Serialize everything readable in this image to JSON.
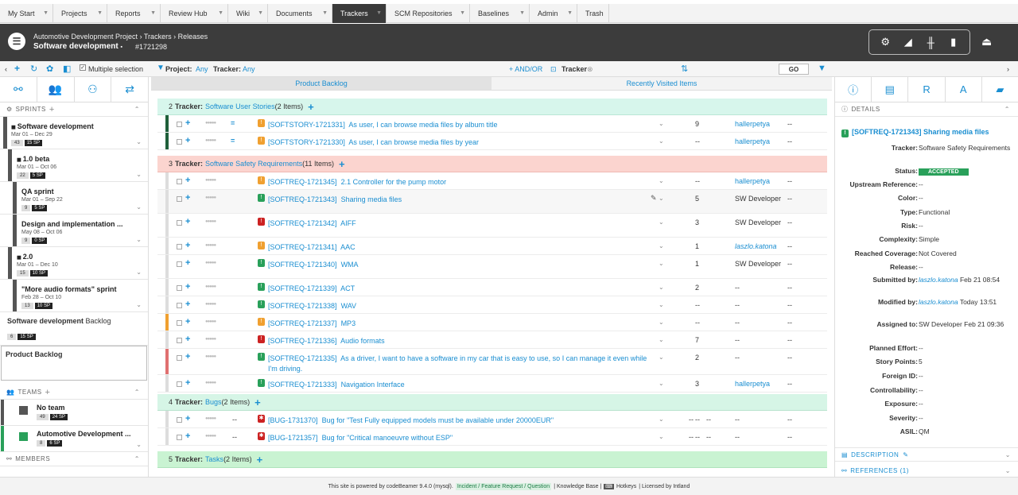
{
  "nav": [
    "My Start",
    "Projects",
    "Reports",
    "Review Hub",
    "Wiki",
    "Documents",
    "Trackers",
    "SCM Repositories",
    "Baselines",
    "Admin",
    "Trash"
  ],
  "header": {
    "breadcrumb": "Automotive Development Project › Trackers › Releases",
    "title": "Software development",
    "title_marker": "▪",
    "id": "#1721298"
  },
  "toolbar": {
    "multiple_selection": "Multiple selection",
    "project_label": "Project:",
    "project_value": "Any",
    "tracker_label": "Tracker:",
    "tracker_value": "Any",
    "andor": "+ AND/OR",
    "tracker_filter": "Tracker",
    "go": "GO"
  },
  "left": {
    "sprints_header": "SPRINTS",
    "sprints": [
      {
        "title": "Software development",
        "dates": "Mar 01 – Dec 29",
        "a": "43",
        "b": "15"
      },
      {
        "title": "1.0 beta",
        "dates": "Mar 01 – Oct 06",
        "a": "22",
        "b": "5"
      },
      {
        "title": "QA sprint",
        "dates": "Mar 01 – Sep 22",
        "a": "9",
        "b": "5"
      },
      {
        "title": "Design and implementation ...",
        "dates": "May 08 – Oct 06",
        "a": "9",
        "b": "0"
      },
      {
        "title": "2.0",
        "dates": "Mar 01 – Dec 10",
        "a": "15",
        "b": "10"
      },
      {
        "title": "\"More audio formats\" sprint",
        "dates": "Feb 28 – Oct 10",
        "a": "13",
        "b": "10"
      }
    ],
    "backlog1_title": "Software development",
    "backlog1_suffix": "Backlog",
    "backlog1_a": "6",
    "backlog1_b": "15",
    "backlog2": "Product Backlog",
    "teams_header": "TEAMS",
    "teams": [
      {
        "title": "No team",
        "a": "49",
        "b": "24"
      },
      {
        "title": "Automotive Development ...",
        "a": "8",
        "b": "6"
      }
    ],
    "members_header": "MEMBERS"
  },
  "tabs": [
    "Product Backlog",
    "Recently Visited Items"
  ],
  "groups": [
    {
      "num": "2",
      "label": "Tracker:",
      "name": "Software User Stories",
      "count": "(2 Items)"
    },
    {
      "num": "3",
      "label": "Tracker:",
      "name": "Software Safety Requirements",
      "count": "(11 Items)"
    },
    {
      "num": "4",
      "label": "Tracker:",
      "name": "Bugs",
      "count": "(2 Items)"
    },
    {
      "num": "5",
      "label": "Tracker:",
      "name": "Tasks",
      "count": "(2 Items)"
    }
  ],
  "rows": [
    {
      "id": "[SOFTSTORY-1721331]",
      "title": "As user, I can browse media files by album title",
      "num": "9",
      "assignee": "hallerpetya",
      "dash": "--"
    },
    {
      "id": "[SOFTSTORY-1721330]",
      "title": "As user, I can browse media files by year",
      "num": "--",
      "assignee": "hallerpetya",
      "dash": "--"
    },
    {
      "id": "[SOFTREQ-1721345]",
      "title": "2.1 Controller for the pump motor",
      "num": "--",
      "assignee": "hallerpetya",
      "dash": "--"
    },
    {
      "id": "[SOFTREQ-1721343]",
      "title": "Sharing media files",
      "num": "5",
      "assignee": "SW Developer",
      "dash": "--"
    },
    {
      "id": "[SOFTREQ-1721342]",
      "title": "AIFF",
      "num": "3",
      "assignee": "SW Developer",
      "dash": "--"
    },
    {
      "id": "[SOFTREQ-1721341]",
      "title": "AAC",
      "num": "1",
      "assignee": "laszlo.katona",
      "dash": "--"
    },
    {
      "id": "[SOFTREQ-1721340]",
      "title": "WMA",
      "num": "1",
      "assignee": "SW Developer",
      "dash": "--"
    },
    {
      "id": "[SOFTREQ-1721339]",
      "title": "ACT",
      "num": "2",
      "assignee": "--",
      "dash": "--"
    },
    {
      "id": "[SOFTREQ-1721338]",
      "title": "WAV",
      "num": "--",
      "assignee": "--",
      "dash": "--"
    },
    {
      "id": "[SOFTREQ-1721337]",
      "title": "MP3",
      "num": "--",
      "assignee": "--",
      "dash": "--"
    },
    {
      "id": "[SOFTREQ-1721336]",
      "title": "Audio formats",
      "num": "7",
      "assignee": "--",
      "dash": "--"
    },
    {
      "id": "[SOFTREQ-1721335]",
      "title": "As a driver, I want to have a software in my car that is easy to use, so I can manage it even while I'm driving.",
      "num": "2",
      "assignee": "--",
      "dash": "--"
    },
    {
      "id": "[SOFTREQ-1721333]",
      "title": "Navigation Interface",
      "num": "3",
      "assignee": "hallerpetya",
      "dash": "--"
    },
    {
      "id": "[BUG-1731370]",
      "title": "Bug for \"Test Fully equipped models must be available under 20000EUR\"",
      "num": "--",
      "assignee": "--",
      "dash": "--"
    },
    {
      "id": "[BUG-1721357]",
      "title": "Bug for \"Critical manoeuvre without ESP\"",
      "num": "--",
      "assignee": "--",
      "dash": "--"
    }
  ],
  "row_misc": {
    "dash": "--",
    "stars": "●●●●●",
    "eq": "="
  },
  "details": {
    "header": "DETAILS",
    "item": "[SOFTREQ-1721343]  Sharing media files",
    "props": [
      {
        "k": "Tracker:",
        "v": "Software Safety Requirements"
      },
      {
        "k": "Status:",
        "v": "ACCEPTED"
      },
      {
        "k": "Upstream Reference:",
        "v": "--"
      },
      {
        "k": "Color:",
        "v": "--"
      },
      {
        "k": "Type:",
        "v": "Functional"
      },
      {
        "k": "Risk:",
        "v": "--"
      },
      {
        "k": "Complexity:",
        "v": "Simple"
      },
      {
        "k": "Reached Coverage:",
        "v": "Not Covered"
      },
      {
        "k": "Release:",
        "v": "--"
      },
      {
        "k": "Submitted by:",
        "v": "laszlo.katona Feb 21 08:54"
      },
      {
        "k": "Modified by:",
        "v": "laszlo.katona Today 13:51"
      },
      {
        "k": "Assigned to:",
        "v": "SW Developer Feb 21 09:36"
      },
      {
        "k": "Planned Effort:",
        "v": "--"
      },
      {
        "k": "Story Points:",
        "v": "5"
      },
      {
        "k": "Foreign ID:",
        "v": "--"
      },
      {
        "k": "Controllability:",
        "v": "--"
      },
      {
        "k": "Exposure:",
        "v": "--"
      },
      {
        "k": "Severity:",
        "v": "--"
      },
      {
        "k": "ASIL:",
        "v": "QM"
      }
    ],
    "description": "DESCRIPTION",
    "references": "REFERENCES (1)"
  },
  "footer": {
    "powered": "This site is powered by codeBeamer 9.4.0 (mysql).",
    "incident": "Incident / Feature Request / Question",
    "kb": "| Knowledge Base |",
    "hotkeys": "Hotkeys",
    "licensed": "| Licensed by Intland"
  },
  "colors": {
    "accent": "#1a8ed1",
    "story_group": "#d7f6ec",
    "req_group": "#fbd4cf",
    "bug_group": "#d6f5e6",
    "task_group": "#c9f3d2",
    "accepted": "#29a05a"
  }
}
